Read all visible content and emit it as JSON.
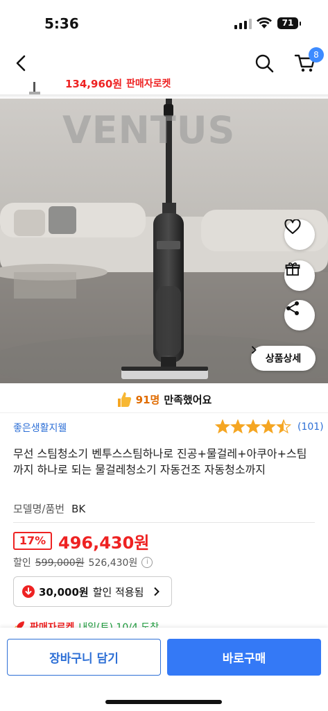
{
  "status": {
    "time": "5:36",
    "battery": "71"
  },
  "nav": {
    "cart_count": "8"
  },
  "peek": {
    "price": "134,960원",
    "rocket": "판매자로켓"
  },
  "hero": {
    "watermark_brand": "VENTUS",
    "detail_button": "상품상세"
  },
  "satisfaction": {
    "count": "91명",
    "text": "만족했어요"
  },
  "seller": "좋은생활지웰",
  "rating": {
    "stars": 4.5,
    "count": "(101)"
  },
  "product": {
    "title": "무선 스팀청소기 벤투스스팀하나로 진공+물걸레+아쿠아+스팀 까지 하나로 되는 물걸레청소기 자동건조 자동청소까지",
    "model_label": "모델명/품번",
    "model_value": "BK"
  },
  "price": {
    "discount_badge": "17%",
    "final": "496,430원",
    "discount_label": "할인",
    "original": "599,000원",
    "sale": "526,430원"
  },
  "coupon": {
    "amount": "30,000원",
    "text": "할인 적용됨"
  },
  "delivery": {
    "rocket": "판매자로켓",
    "date": "내일(토) 10/4 도착"
  },
  "buttons": {
    "cart": "장바구니 담기",
    "buy": "바로구매"
  },
  "colors": {
    "accent_blue": "#3479f6",
    "price_red": "#e22222",
    "seller_blue": "#2d6fd6",
    "star_orange": "#f5a623"
  }
}
